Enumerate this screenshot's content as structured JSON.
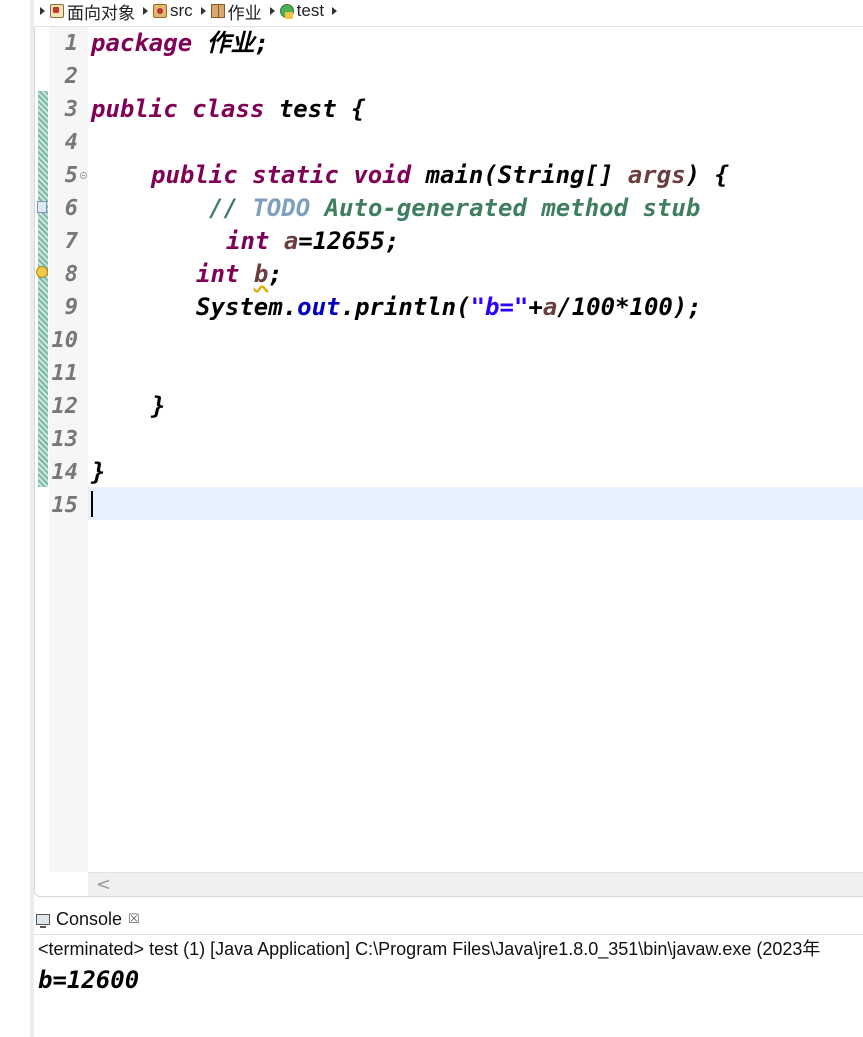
{
  "breadcrumb": [
    {
      "label": "面向对象",
      "icon": "project-icon"
    },
    {
      "label": "src",
      "icon": "source-folder-icon"
    },
    {
      "label": "作业",
      "icon": "package-icon"
    },
    {
      "label": "test",
      "icon": "class-icon"
    }
  ],
  "editor": {
    "line_numbers": [
      "1",
      "2",
      "3",
      "4",
      "5",
      "6",
      "7",
      "8",
      "9",
      "10",
      "11",
      "12",
      "13",
      "14",
      "15"
    ],
    "code": {
      "l1": {
        "kw": "package",
        "rest": " 作业;"
      },
      "l3": {
        "kw1": "public",
        "kw2": "class",
        "name": " test {"
      },
      "l5": {
        "kw1": "public",
        "kw2": "static",
        "kw3": "void",
        "sig": " main(String[] ",
        "param": "args",
        "end": ") {"
      },
      "l6": {
        "comment_start": "// ",
        "todo": "TODO",
        "comment_rest": " Auto-generated method stub"
      },
      "l7": {
        "kw": "int",
        "var": "a",
        "rest": "=12655;"
      },
      "l8": {
        "kw": "int",
        "var": "b",
        "rest": ";"
      },
      "l9": {
        "pre": "System.",
        "field": "out",
        "mid": ".println(",
        "str": "\"b=\"",
        "plus": "+",
        "var": "a",
        "rest": "/100*100);"
      },
      "l12": "}",
      "l14": "}"
    }
  },
  "console": {
    "tab_label": "Console",
    "close_glyph": "☒",
    "status": "<terminated> test (1) [Java Application] C:\\Program Files\\Java\\jre1.8.0_351\\bin\\javaw.exe (2023年",
    "output": "b=12600"
  },
  "colors": {
    "keyword": "#7f0055",
    "comment": "#3f7f5f",
    "todo": "#7f9fbf",
    "string": "#2a00ff",
    "static_field": "#0000c0",
    "local_variable": "#6a3e3e",
    "current_line": "#e8f2fe"
  }
}
